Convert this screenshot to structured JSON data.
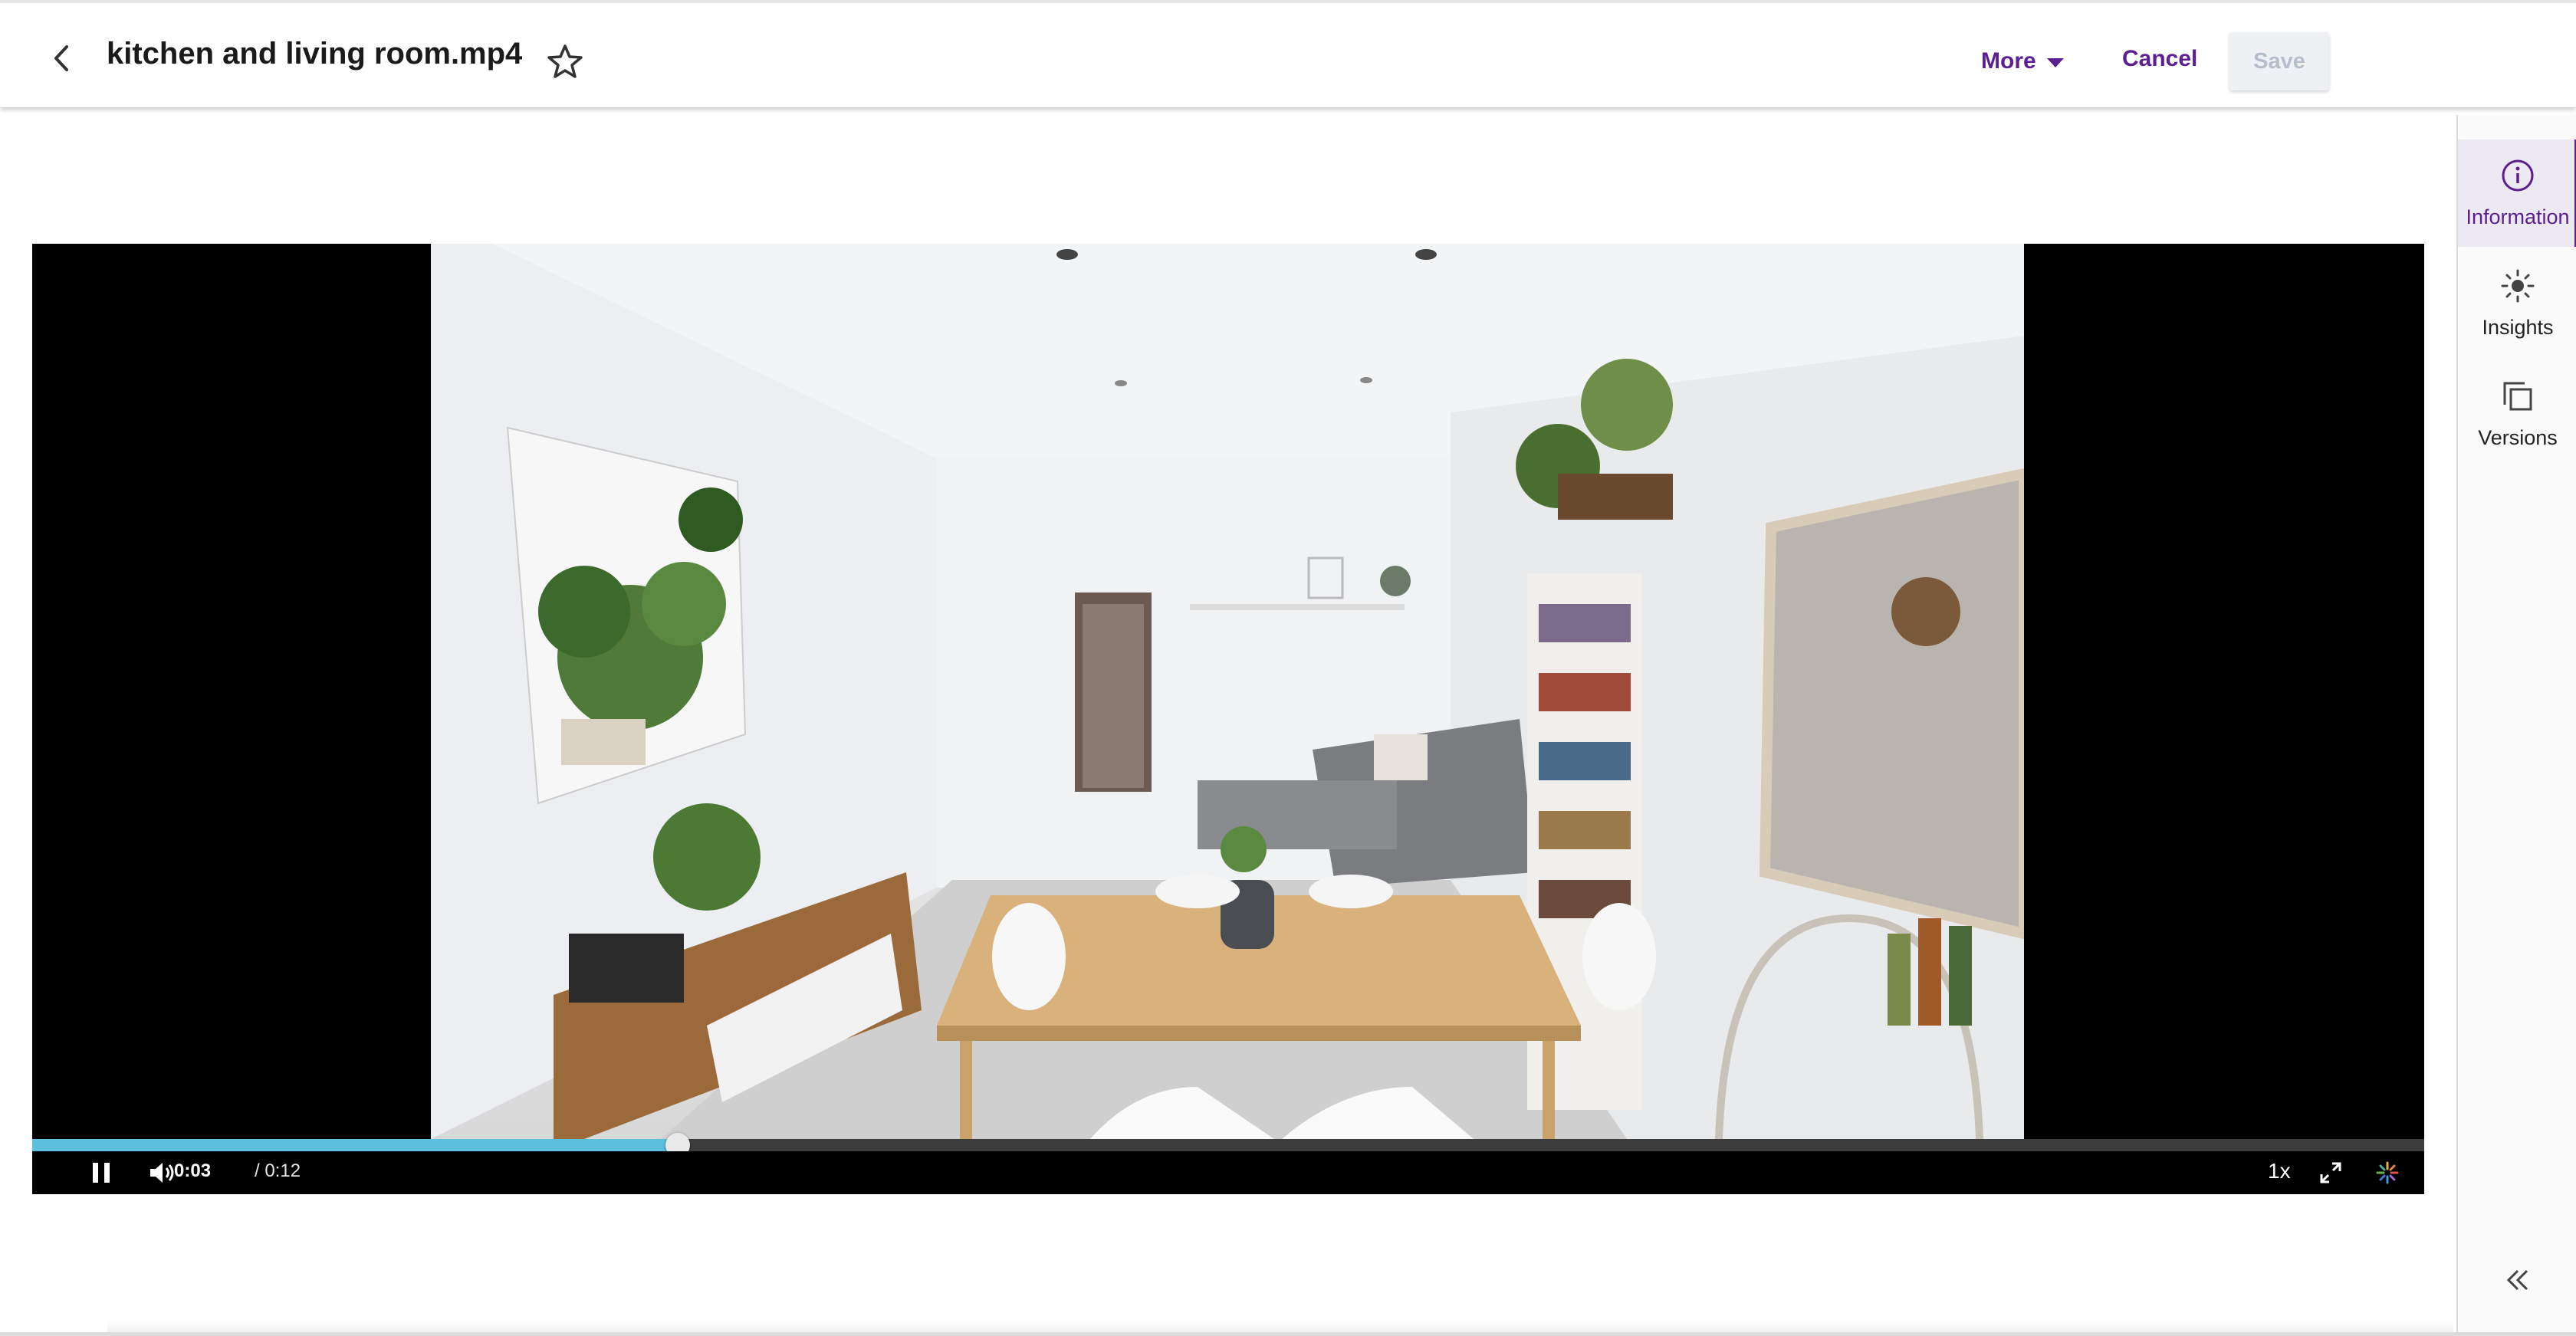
{
  "header": {
    "title": "kitchen and living room.mp4",
    "back_icon": "chevron-left-icon",
    "favorite_icon": "star-outline-icon",
    "more_label": "More",
    "cancel_label": "Cancel",
    "save_label": "Save",
    "save_enabled": false
  },
  "player": {
    "current_time": "0:03",
    "total_time": "/ 0:12",
    "progress": 0.27,
    "speed": "1x",
    "state": "playing"
  },
  "sidebar": {
    "tabs": [
      {
        "label": "Information",
        "icon": "info-circle-icon",
        "active": true
      },
      {
        "label": "Insights",
        "icon": "sun-icon",
        "active": false
      },
      {
        "label": "Versions",
        "icon": "copy-stack-icon",
        "active": false
      }
    ],
    "collapse_icon": "double-chevron-left-icon"
  },
  "colors": {
    "accent": "#5b1f91",
    "progress_fill": "#5bc0de",
    "save_disabled_bg": "#eef0f4"
  }
}
